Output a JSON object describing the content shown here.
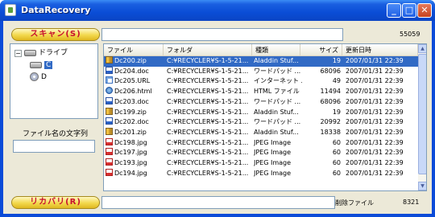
{
  "window": {
    "title": "DataRecovery",
    "controls": {
      "minimize": "_",
      "maximize": "□",
      "close": "✕"
    }
  },
  "toolbar": {
    "scan_label": "スキャン(S)",
    "path_value": "",
    "found_count": "55059"
  },
  "tree": {
    "root_label": "ドライブ",
    "drives": [
      {
        "label": "C",
        "selected": true,
        "icon": "hard-drive-icon"
      },
      {
        "label": "D",
        "selected": false,
        "icon": "cd-drive-icon"
      }
    ]
  },
  "filter": {
    "label": "ファイル名の文字列",
    "value": ""
  },
  "list": {
    "columns": [
      "ファイル",
      "フォルダ",
      "種類",
      "サイズ",
      "更新日時"
    ],
    "rows": [
      {
        "name": "Dc200.zip",
        "folder": "C:¥RECYCLER¥S-1-5-21...",
        "type": "Aladdin Stuf...",
        "size": "19",
        "date": "2007/01/31 22:39",
        "icon": "zip",
        "selected": true
      },
      {
        "name": "Dc204.doc",
        "folder": "C:¥RECYCLER¥S-1-5-21...",
        "type": "ワードパッド ...",
        "size": "68096",
        "date": "2007/01/31 22:39",
        "icon": "doc"
      },
      {
        "name": "Dc205.URL",
        "folder": "C:¥RECYCLER¥S-1-5-21...",
        "type": "インターネット ...",
        "size": "49",
        "date": "2007/01/31 22:39",
        "icon": "url"
      },
      {
        "name": "Dc206.html",
        "folder": "C:¥RECYCLER¥S-1-5-21...",
        "type": "HTML ファイル",
        "size": "11494",
        "date": "2007/01/31 22:39",
        "icon": "html"
      },
      {
        "name": "Dc203.doc",
        "folder": "C:¥RECYCLER¥S-1-5-21...",
        "type": "ワードパッド ...",
        "size": "68096",
        "date": "2007/01/31 22:39",
        "icon": "doc"
      },
      {
        "name": "Dc199.zip",
        "folder": "C:¥RECYCLER¥S-1-5-21...",
        "type": "Aladdin Stuf...",
        "size": "19",
        "date": "2007/01/31 22:39",
        "icon": "zip"
      },
      {
        "name": "Dc202.doc",
        "folder": "C:¥RECYCLER¥S-1-5-21...",
        "type": "ワードパッド ...",
        "size": "20992",
        "date": "2007/01/31 22:39",
        "icon": "doc"
      },
      {
        "name": "Dc201.zip",
        "folder": "C:¥RECYCLER¥S-1-5-21...",
        "type": "Aladdin Stuf...",
        "size": "18338",
        "date": "2007/01/31 22:39",
        "icon": "zip"
      },
      {
        "name": "Dc198.jpg",
        "folder": "C:¥RECYCLER¥S-1-5-21...",
        "type": "JPEG Image",
        "size": "60",
        "date": "2007/01/31 22:39",
        "icon": "jpg"
      },
      {
        "name": "Dc197.jpg",
        "folder": "C:¥RECYCLER¥S-1-5-21...",
        "type": "JPEG Image",
        "size": "60",
        "date": "2007/01/31 22:39",
        "icon": "jpg"
      },
      {
        "name": "Dc193.jpg",
        "folder": "C:¥RECYCLER¥S-1-5-21...",
        "type": "JPEG Image",
        "size": "60",
        "date": "2007/01/31 22:39",
        "icon": "jpg"
      },
      {
        "name": "Dc194.jpg",
        "folder": "C:¥RECYCLER¥S-1-5-21...",
        "type": "JPEG Image",
        "size": "60",
        "date": "2007/01/31 22:39",
        "icon": "jpg"
      }
    ]
  },
  "footer": {
    "recover_label": "リカバリ(R)",
    "status_value": "",
    "deleted_label": "削除ファイル",
    "deleted_count": "8321"
  }
}
